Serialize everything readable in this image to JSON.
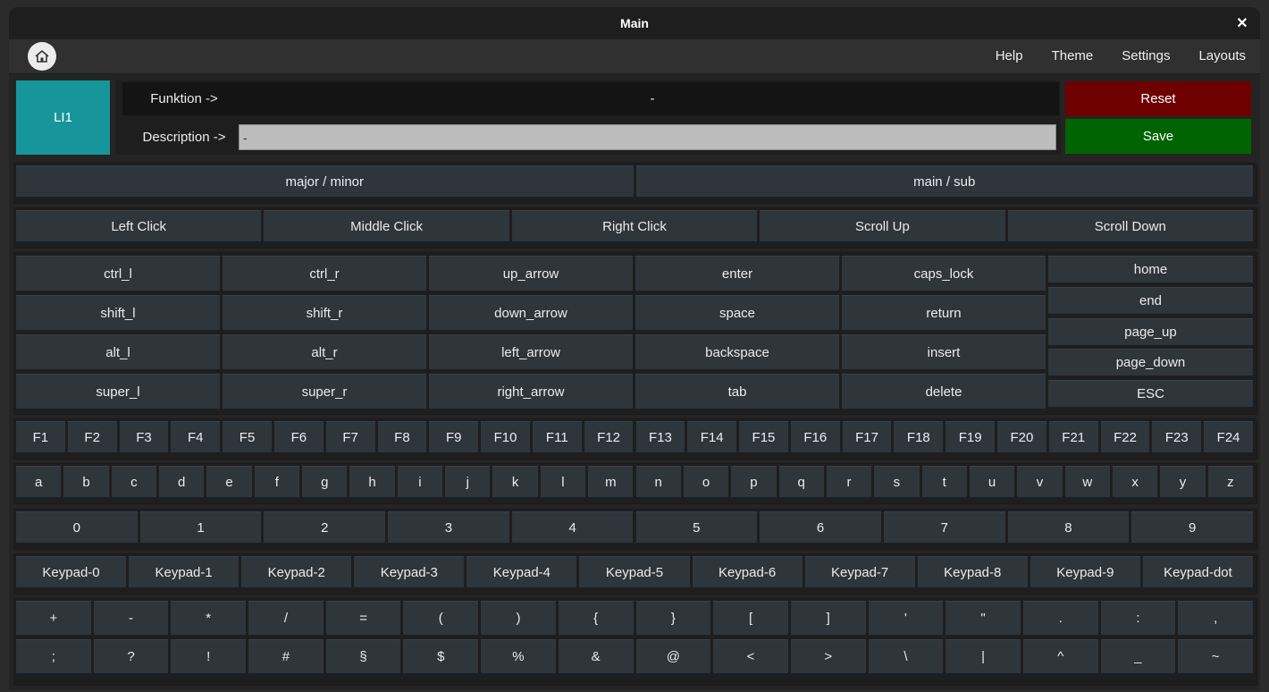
{
  "window": {
    "title": "Main"
  },
  "icons": {
    "close": "close-icon",
    "home": "home-icon"
  },
  "menu": [
    "Help",
    "Theme",
    "Settings",
    "Layouts"
  ],
  "colors": {
    "accent": "#16969a",
    "reset": "#6e0000",
    "save": "#006400",
    "button": "#2e353b",
    "background": "#242424"
  },
  "header": {
    "key_label": "LI1",
    "function_label": "Funktion ->",
    "function_value": "-",
    "description_label": "Description ->",
    "description_value": "-",
    "reset_label": "Reset",
    "save_label": "Save"
  },
  "mode_buttons": [
    "major / minor",
    "main / sub"
  ],
  "mouse_buttons": [
    "Left Click",
    "Middle Click",
    "Right Click",
    "Scroll Up",
    "Scroll Down"
  ],
  "special_keys": [
    [
      "ctrl_l",
      "shift_l",
      "alt_l",
      "super_l"
    ],
    [
      "ctrl_r",
      "shift_r",
      "alt_r",
      "super_r"
    ],
    [
      "up_arrow",
      "down_arrow",
      "left_arrow",
      "right_arrow"
    ],
    [
      "enter",
      "space",
      "backspace",
      "tab"
    ],
    [
      "caps_lock",
      "return",
      "insert",
      "delete"
    ]
  ],
  "nav_keys": [
    "home",
    "end",
    "page_up",
    "page_down",
    "ESC"
  ],
  "function_keys": [
    "F1",
    "F2",
    "F3",
    "F4",
    "F5",
    "F6",
    "F7",
    "F8",
    "F9",
    "F10",
    "F11",
    "F12",
    "F13",
    "F14",
    "F15",
    "F16",
    "F17",
    "F18",
    "F19",
    "F20",
    "F21",
    "F22",
    "F23",
    "F24"
  ],
  "letters": [
    "a",
    "b",
    "c",
    "d",
    "e",
    "f",
    "g",
    "h",
    "i",
    "j",
    "k",
    "l",
    "m",
    "n",
    "o",
    "p",
    "q",
    "r",
    "s",
    "t",
    "u",
    "v",
    "w",
    "x",
    "y",
    "z"
  ],
  "digits": [
    "0",
    "1",
    "2",
    "3",
    "4",
    "5",
    "6",
    "7",
    "8",
    "9"
  ],
  "keypad": [
    "Keypad-0",
    "Keypad-1",
    "Keypad-2",
    "Keypad-3",
    "Keypad-4",
    "Keypad-5",
    "Keypad-6",
    "Keypad-7",
    "Keypad-8",
    "Keypad-9",
    "Keypad-dot"
  ],
  "symbols_row1": [
    "+",
    "-",
    "*",
    "/",
    "=",
    "(",
    ")",
    "{",
    "}",
    "[",
    "]",
    "'",
    "\"",
    ".",
    ":",
    ","
  ],
  "symbols_row2": [
    ";",
    "?",
    "!",
    "#",
    "§",
    "$",
    "%",
    "&",
    "@",
    "<",
    ">",
    "\\",
    "|",
    "^",
    "_",
    "~"
  ]
}
